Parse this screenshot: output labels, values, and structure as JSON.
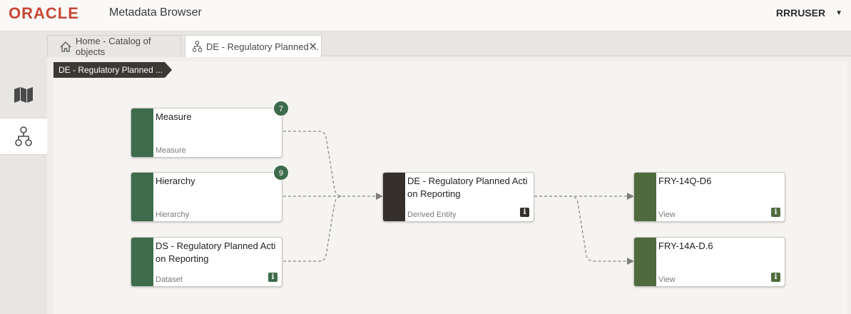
{
  "header": {
    "logo": "ORACLE",
    "app_title": "Metadata Browser",
    "user": "RRRUSER"
  },
  "tabs": [
    {
      "label": "Home - Catalog of objects",
      "icon": "home-icon"
    },
    {
      "label": "DE - Regulatory Planned ...",
      "icon": "lineage-icon",
      "close": "✕"
    }
  ],
  "breadcrumb": "DE - Regulatory Planned ...",
  "nodes": {
    "measure": {
      "title": "Measure",
      "type": "Measure",
      "badge": "7",
      "color": "#3d6b4b"
    },
    "hierarchy": {
      "title": "Hierarchy",
      "type": "Hierarchy",
      "badge": "9",
      "color": "#3d6b4b"
    },
    "dataset": {
      "title": "DS - Regulatory Planned Acti on Reporting",
      "type": "Dataset",
      "info": "i",
      "color": "#3d6b4b"
    },
    "derived": {
      "title": "DE - Regulatory Planned Acti on Reporting",
      "type": "Derived Entity",
      "info": "i",
      "color": "#35302c"
    },
    "view1": {
      "title": "FRY-14Q-D6",
      "type": "View",
      "info": "i",
      "color": "#4f6b3e"
    },
    "view2": {
      "title": "FRY-14A-D.6",
      "type": "View",
      "info": "i",
      "color": "#4f6b3e"
    }
  },
  "rail": [
    {
      "icon": "map-icon"
    },
    {
      "icon": "lineage-icon",
      "active": true
    }
  ]
}
